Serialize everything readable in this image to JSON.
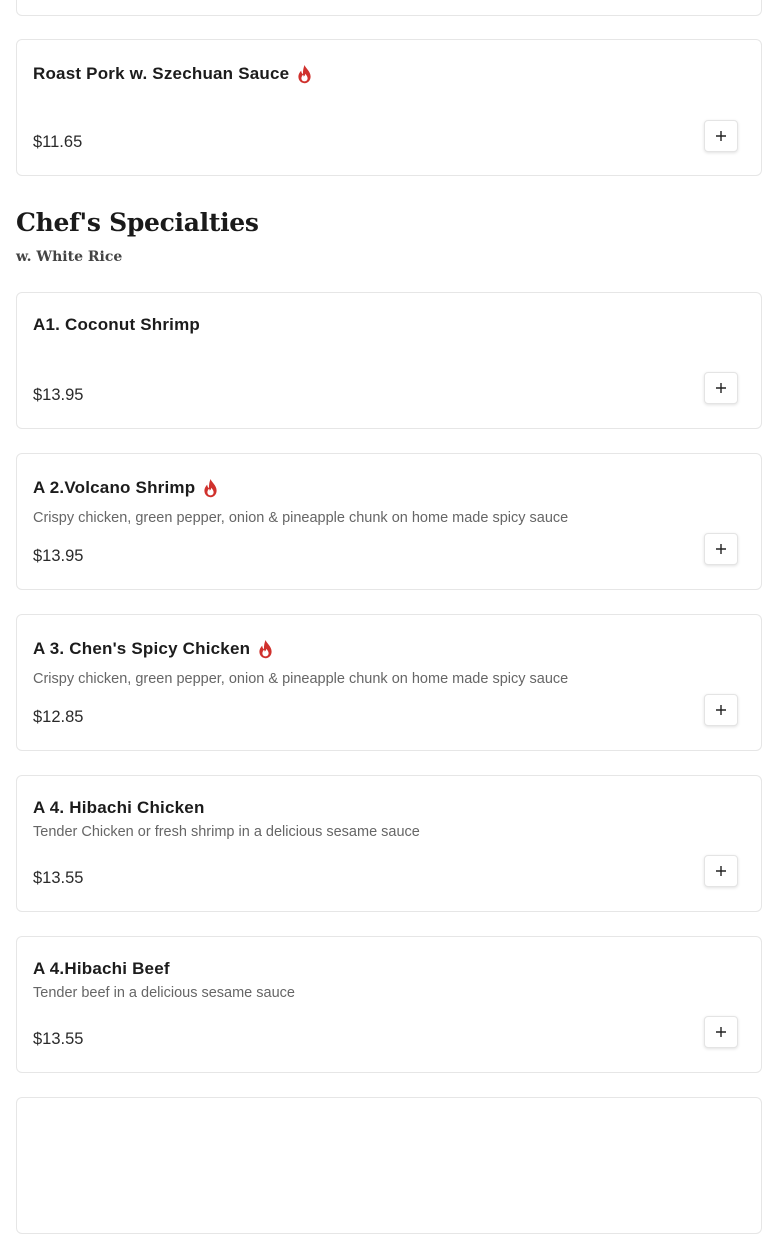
{
  "previous_item": {
    "name": "Roast Pork w. Szechuan Sauce",
    "price": "$11.65",
    "spicy": true
  },
  "section": {
    "title": "Chef's Specialties",
    "subtitle": "w. White Rice"
  },
  "items": [
    {
      "name": "A1. Coconut Shrimp",
      "description": "",
      "price": "$13.95",
      "spicy": false
    },
    {
      "name": "A 2.Volcano Shrimp",
      "description": "Crispy chicken, green pepper, onion & pineapple chunk on home made spicy sauce",
      "price": "$13.95",
      "spicy": true
    },
    {
      "name": "A 3. Chen's Spicy Chicken",
      "description": "Crispy chicken, green pepper, onion & pineapple chunk on home made spicy sauce",
      "price": "$12.85",
      "spicy": true
    },
    {
      "name": "A 4. Hibachi Chicken",
      "description": "Tender Chicken or fresh shrimp in a delicious sesame sauce",
      "price": "$13.55",
      "spicy": false
    },
    {
      "name": "A 4.Hibachi Beef",
      "description": "Tender beef in a delicious sesame sauce",
      "price": "$13.55",
      "spicy": false
    }
  ],
  "icons": {
    "spicy": "fire-icon",
    "add": "plus-icon"
  },
  "colors": {
    "spicy": "#d0312d",
    "card_border": "#e6e6e6"
  }
}
